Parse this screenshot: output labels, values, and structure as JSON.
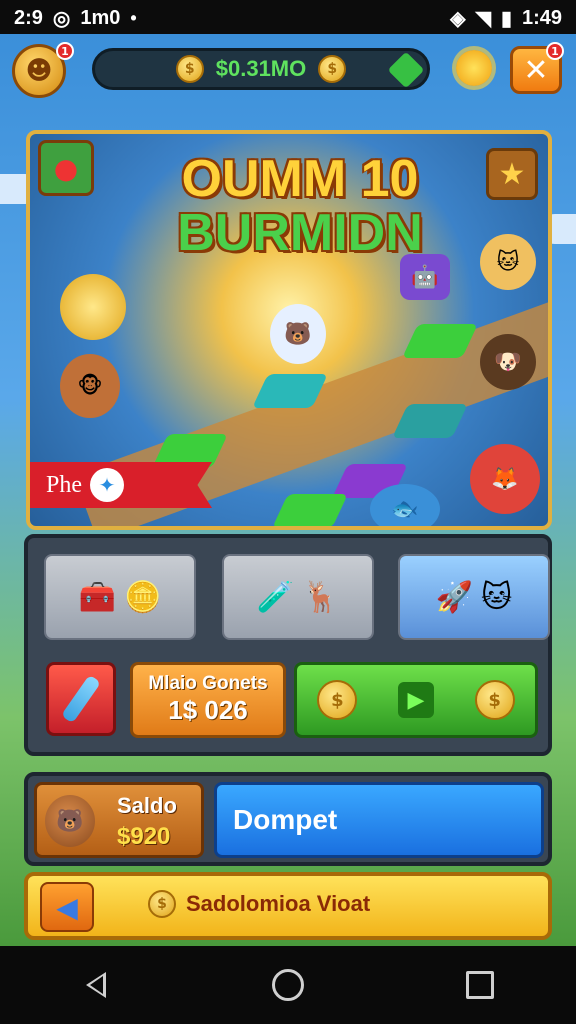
{
  "status_bar": {
    "time_left": "2:9",
    "carrier": "1m0",
    "dot": "•",
    "time_right": "1:49"
  },
  "hud": {
    "avatar_badge": "1",
    "currency_value": "$0.31MO",
    "close_badge": "1"
  },
  "banner": {
    "title_line1": "OUMM 10",
    "title_line2": "BURMIDN",
    "ribbon_text": "Phe"
  },
  "shop": {
    "mega_label": "Mlaio Gonets",
    "mega_price": "1$ 026"
  },
  "balance": {
    "saldo_label": "Saldo",
    "saldo_value": "$920",
    "dompet_label": "Dompet"
  },
  "bottom": {
    "promo_text": "Sadolomioa Vioat"
  },
  "colors": {
    "accent_green": "#5fe25f",
    "accent_blue": "#1a70e0",
    "accent_orange": "#f07b10",
    "accent_yellow": "#ffd23a"
  },
  "icons": [
    "avatar-icon",
    "coin-icon",
    "gem-icon",
    "sun-icon",
    "close-icon",
    "star-icon",
    "play-icon",
    "back-arrow-icon",
    "pen-icon",
    "home-icon",
    "recents-icon"
  ]
}
